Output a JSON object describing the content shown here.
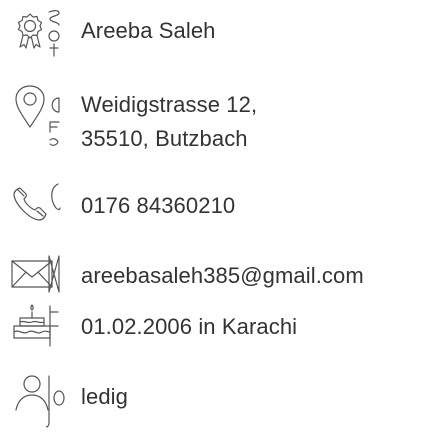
{
  "contact": {
    "name": "Areeba Saleh",
    "address_line1": "Weidigstrasse 12,",
    "address_line2": "35510, Butzbach",
    "phone": "0176 84360210",
    "email": "areebasaleh385@gmail.com",
    "birth": "01.02.2006 in Karachi",
    "status": "ledig"
  },
  "icons": {
    "name": "award-badge-icon",
    "address": "map-pin-icon",
    "phone": "phone-icon",
    "email": "envelope-icon",
    "birth": "birthday-cake-icon",
    "status": "person-icon"
  },
  "colors": {
    "text": "#333333",
    "icon_stroke": "#555555"
  }
}
